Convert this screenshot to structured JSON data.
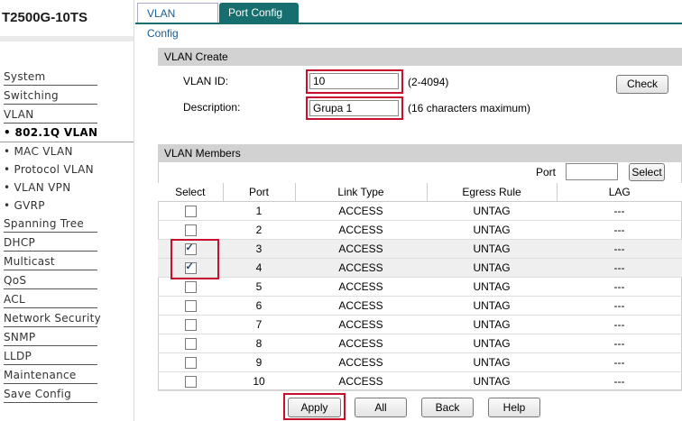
{
  "device": {
    "title": "T2500G-10TS"
  },
  "sidebar": {
    "items": [
      {
        "label": "System"
      },
      {
        "label": "Switching"
      },
      {
        "label": "VLAN"
      },
      {
        "label": "• 802.1Q VLAN"
      },
      {
        "label": "• MAC VLAN"
      },
      {
        "label": "• Protocol VLAN"
      },
      {
        "label": "• VLAN VPN"
      },
      {
        "label": "• GVRP"
      },
      {
        "label": "Spanning Tree"
      },
      {
        "label": "DHCP"
      },
      {
        "label": "Multicast"
      },
      {
        "label": "QoS"
      },
      {
        "label": "ACL"
      },
      {
        "label": "Network Security"
      },
      {
        "label": "SNMP"
      },
      {
        "label": "LLDP"
      },
      {
        "label": "Maintenance"
      },
      {
        "label": "Save Config"
      }
    ],
    "active": "• 802.1Q VLAN"
  },
  "tabs": [
    {
      "label": "VLAN Config"
    },
    {
      "label": "Port Config"
    }
  ],
  "vlan_create": {
    "heading": "VLAN Create",
    "vlan_id_label": "VLAN ID:",
    "vlan_id_value": "10",
    "vlan_id_hint": "(2-4094)",
    "description_label": "Description:",
    "description_value": "Grupa 1",
    "description_hint": "(16 characters maximum)",
    "check_label": "Check"
  },
  "vlan_members": {
    "heading": "VLAN Members",
    "port_filter_label": "Port",
    "port_filter_value": "",
    "select_button": "Select",
    "columns": [
      "Select",
      "Port",
      "Link Type",
      "Egress Rule",
      "LAG"
    ],
    "rows": [
      {
        "checked": false,
        "port": "1",
        "link_type": "ACCESS",
        "egress": "UNTAG",
        "lag": "---"
      },
      {
        "checked": false,
        "port": "2",
        "link_type": "ACCESS",
        "egress": "UNTAG",
        "lag": "---"
      },
      {
        "checked": true,
        "port": "3",
        "link_type": "ACCESS",
        "egress": "UNTAG",
        "lag": "---"
      },
      {
        "checked": true,
        "port": "4",
        "link_type": "ACCESS",
        "egress": "UNTAG",
        "lag": "---"
      },
      {
        "checked": false,
        "port": "5",
        "link_type": "ACCESS",
        "egress": "UNTAG",
        "lag": "---"
      },
      {
        "checked": false,
        "port": "6",
        "link_type": "ACCESS",
        "egress": "UNTAG",
        "lag": "---"
      },
      {
        "checked": false,
        "port": "7",
        "link_type": "ACCESS",
        "egress": "UNTAG",
        "lag": "---"
      },
      {
        "checked": false,
        "port": "8",
        "link_type": "ACCESS",
        "egress": "UNTAG",
        "lag": "---"
      },
      {
        "checked": false,
        "port": "9",
        "link_type": "ACCESS",
        "egress": "UNTAG",
        "lag": "---"
      },
      {
        "checked": false,
        "port": "10",
        "link_type": "ACCESS",
        "egress": "UNTAG",
        "lag": "---"
      }
    ]
  },
  "actions": {
    "apply": "Apply",
    "all": "All",
    "back": "Back",
    "help": "Help"
  },
  "colors": {
    "highlight_box": "#c8102e",
    "tab_active_bg": "#176e6e",
    "section_header_bg": "#d2d2d2"
  }
}
